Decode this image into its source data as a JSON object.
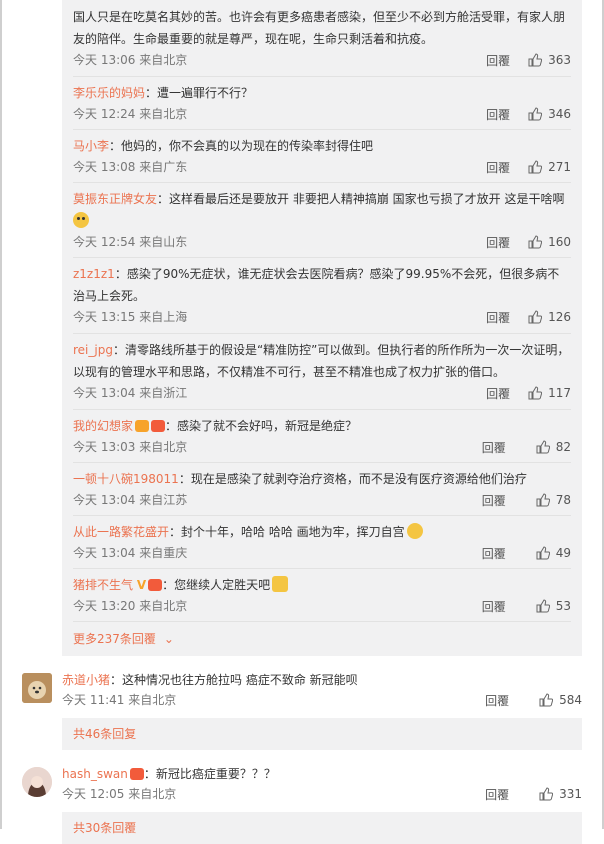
{
  "sub_comments": [
    {
      "name": "",
      "text": "国人只是在吃莫名其妙的苦。也许会有更多癌患者感染，但至少不必到方舱活受罪，有家人朋友的陪伴。生命最重要的就是尊严，现在呢，生命只剩活着和抗疫。",
      "time": "今天 13:06 来自北京",
      "reply_label": "回覆",
      "likes": "363"
    },
    {
      "name": "李乐乐的妈妈",
      "text": "：遭一遍罪行不行？",
      "time": "今天 12:24 来自北京",
      "reply_label": "回覆",
      "likes": "346"
    },
    {
      "name": "马小李",
      "text": "：他妈的，你不会真的以为现在的传染率封得住吧",
      "time": "今天 13:08 来自广东",
      "reply_label": "回覆",
      "likes": "271"
    },
    {
      "name": "莫振东正牌女友",
      "text": "：这样看最后还是要放开 非要把人精神搞崩 国家也亏损了才放开 这是干啥啊",
      "emoji": "crying-emoji",
      "time": "今天 12:54 来自山东",
      "reply_label": "回覆",
      "likes": "160"
    },
    {
      "name": "z1z1z1",
      "text": "：感染了90%无症状，谁无症状会去医院看病？感染了99.95%不会死，但很多病不治马上会死。",
      "time": "今天 13:15 来自上海",
      "reply_label": "回覆",
      "likes": "126"
    },
    {
      "name": "rei_jpg",
      "text": "：清零路线所基于的假设是“精准防控”可以做到。但执行者的所作所为一次一次证明，以现有的管理水平和思路，不仅精准不可行，甚至不精准也成了权力扩张的借口。",
      "time": "今天 13:04 来自浙江",
      "reply_label": "回覆",
      "likes": "117"
    },
    {
      "name": "我的幻想家",
      "text": "：感染了就不会好吗，新冠是绝症？",
      "time": "今天 13:03 来自北京",
      "reply_label": "回覆",
      "likes": "82"
    },
    {
      "name": "一顿十八碗198011",
      "text": "：现在是感染了就剥夺治疗资格，而不是没有医疗资源给他们治疗",
      "time": "今天 13:04 来自江苏",
      "reply_label": "回覆",
      "likes": "78"
    },
    {
      "name": "从此一路繁花盛开",
      "text": "：封个十年，哈哈 哈哈 画地为牢，挥刀自宫",
      "time": "今天 13:04 来自重庆",
      "reply_label": "回覆",
      "likes": "49"
    },
    {
      "name": "猪排不生气",
      "v_mark": "V",
      "text": "：您继续人定胜天吧",
      "time": "今天 13:20 来自北京",
      "reply_label": "回覆",
      "likes": "53"
    }
  ],
  "more_sub_replies": "更多237条回覆",
  "comments": [
    {
      "name": "赤道小猪",
      "text": "：这种情况也往方舱拉吗 癌症不致命 新冠能呗",
      "time": "今天 11:41 来自北京",
      "reply_label": "回覆",
      "likes": "584",
      "total_replies": "共46条回复"
    },
    {
      "name": "hash_swan",
      "text": "：新冠比癌症重要？？？",
      "time": "今天 12:05 来自北京",
      "reply_label": "回覆",
      "likes": "331",
      "total_replies": "共30条回覆"
    }
  ],
  "colors": {
    "accent": "#eb7350",
    "panel": "#f1f1f2"
  }
}
